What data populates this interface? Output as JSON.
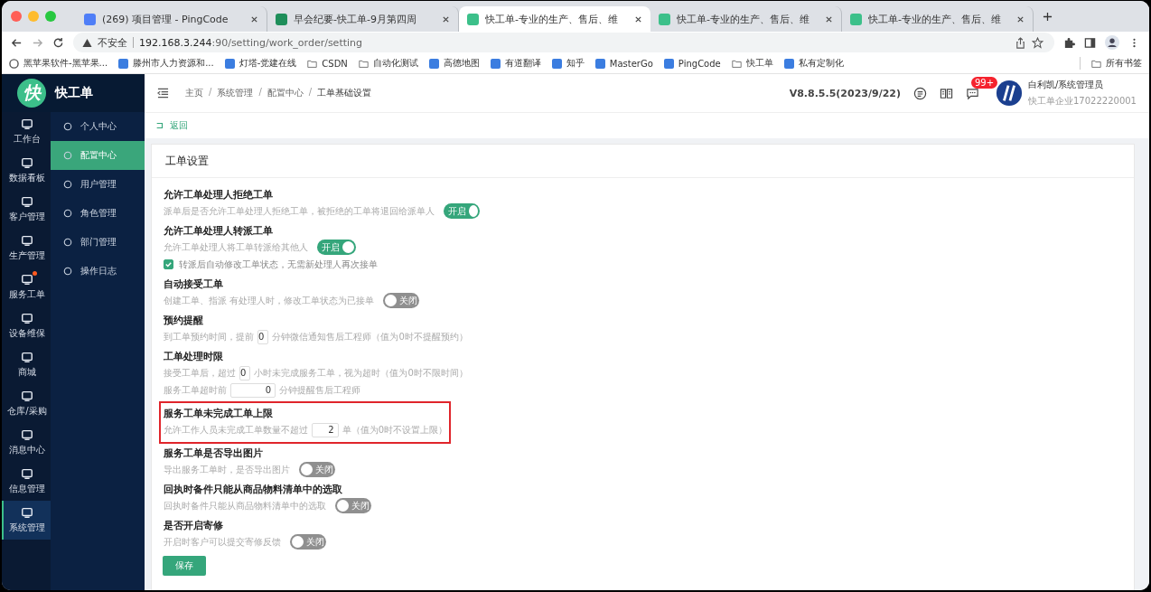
{
  "browser": {
    "tabs": [
      {
        "title": "(269) 项目管理 - PingCode",
        "kind": "pingcode",
        "selected": false
      },
      {
        "title": "早会纪要-快工单-9月第四周",
        "kind": "sheet",
        "selected": false
      },
      {
        "title": "快工单-专业的生产、售后、维",
        "kind": "app",
        "selected": true
      },
      {
        "title": "快工单-专业的生产、售后、维",
        "kind": "app",
        "selected": false
      },
      {
        "title": "快工单-专业的生产、售后、维",
        "kind": "app",
        "selected": false
      }
    ],
    "address": {
      "warning": "不安全",
      "host": "192.168.3.244",
      "path": ":90/setting/work_order/setting"
    },
    "bookmarks": [
      {
        "label": "黑苹果软件-黑苹果...",
        "kind": "circle"
      },
      {
        "label": "滕州市人力资源和...",
        "kind": "site"
      },
      {
        "label": "灯塔-党建在线",
        "kind": "site"
      },
      {
        "label": "CSDN",
        "kind": "folder"
      },
      {
        "label": "自动化测试",
        "kind": "folder"
      },
      {
        "label": "高德地图",
        "kind": "site"
      },
      {
        "label": "有道翻译",
        "kind": "site"
      },
      {
        "label": "知乎",
        "kind": "site"
      },
      {
        "label": "MasterGo",
        "kind": "site"
      },
      {
        "label": "PingCode",
        "kind": "site"
      },
      {
        "label": "快工单",
        "kind": "folder"
      },
      {
        "label": "私有定制化",
        "kind": "site"
      }
    ],
    "all_bookmarks": "所有书签"
  },
  "app": {
    "logo": "快",
    "name": "快工单",
    "rail": [
      {
        "label": "工作台",
        "selected": false,
        "dot": false
      },
      {
        "label": "数据看板",
        "selected": false,
        "dot": false
      },
      {
        "label": "客户管理",
        "selected": false,
        "dot": false
      },
      {
        "label": "生产管理",
        "selected": false,
        "dot": false
      },
      {
        "label": "服务工单",
        "selected": false,
        "dot": true
      },
      {
        "label": "设备维保",
        "selected": false,
        "dot": false
      },
      {
        "label": "商城",
        "selected": false,
        "dot": false
      },
      {
        "label": "仓库/采购",
        "selected": false,
        "dot": false
      },
      {
        "label": "消息中心",
        "selected": false,
        "dot": false
      },
      {
        "label": "信息管理",
        "selected": false,
        "dot": false
      },
      {
        "label": "系统管理",
        "selected": true,
        "dot": false
      }
    ],
    "submenu": [
      {
        "label": "个人中心",
        "selected": false
      },
      {
        "label": "配置中心",
        "selected": true
      },
      {
        "label": "用户管理",
        "selected": false
      },
      {
        "label": "角色管理",
        "selected": false
      },
      {
        "label": "部门管理",
        "selected": false
      },
      {
        "label": "操作日志",
        "selected": false
      }
    ],
    "breadcrumb": [
      "主页",
      "系统管理",
      "配置中心",
      "工单基础设置"
    ],
    "breadcrumb_separator": "/",
    "version": "V8.8.5.5(2023/9/22)",
    "message_badge": "99+",
    "user": {
      "name": "白利凯/系统管理员",
      "company": "快工单企业17022220001"
    },
    "back": "返回",
    "card_title": "工单设置",
    "settings": [
      {
        "title": "允许工单处理人拒绝工单",
        "highlighted": false,
        "lines": [
          [
            {
              "kind": "text",
              "text": "派单后是否允许工单处理人拒绝工单，被拒绝的工单将退回给派单人"
            },
            {
              "kind": "switch",
              "on": true,
              "label": "开启"
            }
          ]
        ]
      },
      {
        "title": "允许工单处理人转派工单",
        "highlighted": false,
        "lines": [
          [
            {
              "kind": "text",
              "text": "允许工单处理人将工单转派给其他人"
            },
            {
              "kind": "switch",
              "on": true,
              "label": "开启"
            }
          ],
          [
            {
              "kind": "checkbox",
              "checked": true,
              "text": "转派后自动修改工单状态，无需新处理人再次接单"
            }
          ]
        ]
      },
      {
        "title": "自动接受工单",
        "highlighted": false,
        "lines": [
          [
            {
              "kind": "text",
              "text": "创建工单、指派 有处理人时，修改工单状态为已接单"
            },
            {
              "kind": "switch",
              "on": false,
              "label": "关闭"
            }
          ]
        ]
      },
      {
        "title": "预约提醒",
        "highlighted": false,
        "lines": [
          [
            {
              "kind": "text",
              "text": "到工单预约时间，提前"
            },
            {
              "kind": "input",
              "value": "0"
            },
            {
              "kind": "text",
              "text": "分钟微信通知售后工程师（值为0时不提醒预约）"
            }
          ]
        ]
      },
      {
        "title": "工单处理时限",
        "highlighted": false,
        "lines": [
          [
            {
              "kind": "text",
              "text": "接受工单后，超过"
            },
            {
              "kind": "input",
              "value": "0"
            },
            {
              "kind": "text",
              "text": "小时未完成服务工单，视为超时（值为0时不限时间）"
            }
          ],
          [
            {
              "kind": "text",
              "text": "服务工单超时前"
            },
            {
              "kind": "input",
              "value": "0"
            },
            {
              "kind": "text",
              "text": "分钟提醒售后工程师"
            }
          ]
        ]
      },
      {
        "title": "服务工单未完成工单上限",
        "highlighted": true,
        "lines": [
          [
            {
              "kind": "text",
              "text": "允许工作人员未完成工单数量不超过"
            },
            {
              "kind": "input",
              "value": "2"
            },
            {
              "kind": "text",
              "text": "单（值为0时不设置上限）"
            }
          ]
        ]
      },
      {
        "title": "服务工单是否导出图片",
        "highlighted": false,
        "lines": [
          [
            {
              "kind": "text",
              "text": "导出服务工单时，是否导出图片"
            },
            {
              "kind": "switch",
              "on": false,
              "label": "关闭"
            }
          ]
        ]
      },
      {
        "title": "回执时备件只能从商品物料清单中的选取",
        "highlighted": false,
        "lines": [
          [
            {
              "kind": "text",
              "text": "回执时备件只能从商品物料清单中的选取"
            },
            {
              "kind": "switch",
              "on": false,
              "label": "关闭"
            }
          ]
        ]
      },
      {
        "title": "是否开启寄修",
        "highlighted": false,
        "lines": [
          [
            {
              "kind": "text",
              "text": "开启时客户可以提交寄修反馈"
            },
            {
              "kind": "switch",
              "on": false,
              "label": "关闭"
            }
          ]
        ]
      }
    ],
    "save": "保存"
  }
}
